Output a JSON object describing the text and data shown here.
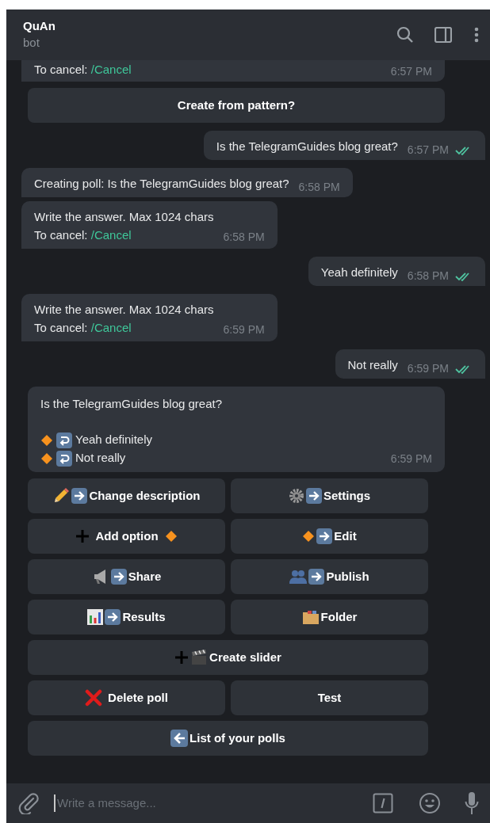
{
  "header": {
    "title": "QuAn",
    "subtitle": "bot"
  },
  "messages": [
    {
      "kind": "in",
      "lines": [
        [
          {
            "text": "To cancel: "
          },
          {
            "text": "/Cancel",
            "link": true
          }
        ]
      ],
      "time": "6:57 PM"
    },
    {
      "kind": "button",
      "label": "Create from pattern?"
    },
    {
      "kind": "out",
      "lines": [
        [
          {
            "text": "Is the TelegramGuides blog great?"
          }
        ]
      ],
      "time": "6:57 PM",
      "read": true
    },
    {
      "kind": "in",
      "lines": [
        [
          {
            "text": "Creating poll: Is the TelegramGuides blog great?"
          }
        ]
      ],
      "time": "6:58 PM"
    },
    {
      "kind": "in",
      "lines": [
        [
          {
            "text": "Write the answer. Max 1024 chars"
          }
        ],
        [
          {
            "text": "To cancel: "
          },
          {
            "text": "/Cancel",
            "link": true
          }
        ]
      ],
      "time": "6:58 PM"
    },
    {
      "kind": "out",
      "lines": [
        [
          {
            "text": "Yeah definitely"
          }
        ]
      ],
      "time": "6:58 PM",
      "read": true
    },
    {
      "kind": "in",
      "lines": [
        [
          {
            "text": "Write the answer. Max 1024 chars"
          }
        ],
        [
          {
            "text": "To cancel: "
          },
          {
            "text": "/Cancel",
            "link": true
          }
        ]
      ],
      "time": "6:59 PM"
    },
    {
      "kind": "out",
      "lines": [
        [
          {
            "text": "Not really"
          }
        ]
      ],
      "time": "6:59 PM",
      "read": true
    }
  ],
  "poll": {
    "question": "Is the TelegramGuides blog great?",
    "options": [
      "Yeah definitely",
      "Not really"
    ],
    "time": "6:59 PM"
  },
  "keyboard": [
    [
      {
        "label": "Change description"
      },
      {
        "label": "Settings"
      }
    ],
    [
      {
        "label": "Add option"
      },
      {
        "label": "Edit"
      }
    ],
    [
      {
        "label": "Share"
      },
      {
        "label": "Publish"
      }
    ],
    [
      {
        "label": "Results"
      },
      {
        "label": "Folder"
      }
    ],
    [
      {
        "label": "Create slider"
      }
    ],
    [
      {
        "label": "Delete poll"
      },
      {
        "label": "Test"
      }
    ],
    [
      {
        "label": "List of your polls"
      }
    ]
  ],
  "composer": {
    "placeholder": "Write a message..."
  }
}
